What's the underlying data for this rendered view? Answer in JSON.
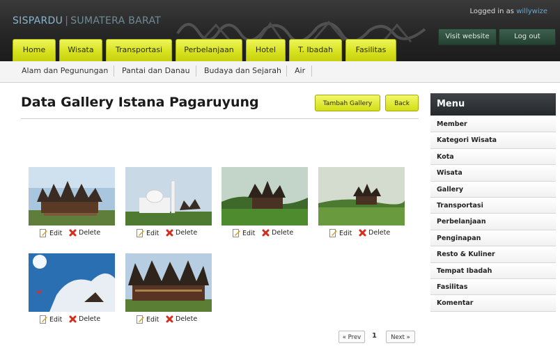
{
  "header": {
    "brand_primary": "SISPARDU",
    "brand_separator": "|",
    "brand_secondary": "SUMATERA BARAT",
    "logged_in_prefix": "Logged in as",
    "username": "willywize",
    "visit_website_label": "Visit website",
    "logout_label": "Log out"
  },
  "tabs": [
    "Home",
    "Wisata",
    "Transportasi",
    "Perbelanjaan",
    "Hotel",
    "T. Ibadah",
    "Fasilitas"
  ],
  "subnav": [
    "Alam dan Pegunungan",
    "Pantai dan Danau",
    "Budaya dan Sejarah",
    "Air"
  ],
  "page": {
    "title": "Data Gallery Istana Pagaruyung",
    "add_button": "Tambah Gallery",
    "back_button": "Back"
  },
  "gallery": {
    "edit_label": "Edit",
    "delete_label": "Delete",
    "item_count": 6
  },
  "pagination": {
    "prev": "« Prev",
    "current": "1",
    "next": "Next »"
  },
  "sidebar": {
    "title": "Menu",
    "items": [
      "Member",
      "Kategori Wisata",
      "Kota",
      "Wisata",
      "Gallery",
      "Transportasi",
      "Perbelanjaan",
      "Penginapan",
      "Resto & Kuliner",
      "Tempat Ibadah",
      "Fasilitas",
      "Komentar"
    ]
  },
  "colors": {
    "tab_yellow": "#d8e21f",
    "header_dark": "#262626",
    "button_green": "#2f4f3d",
    "delete_red": "#d32d1e"
  }
}
